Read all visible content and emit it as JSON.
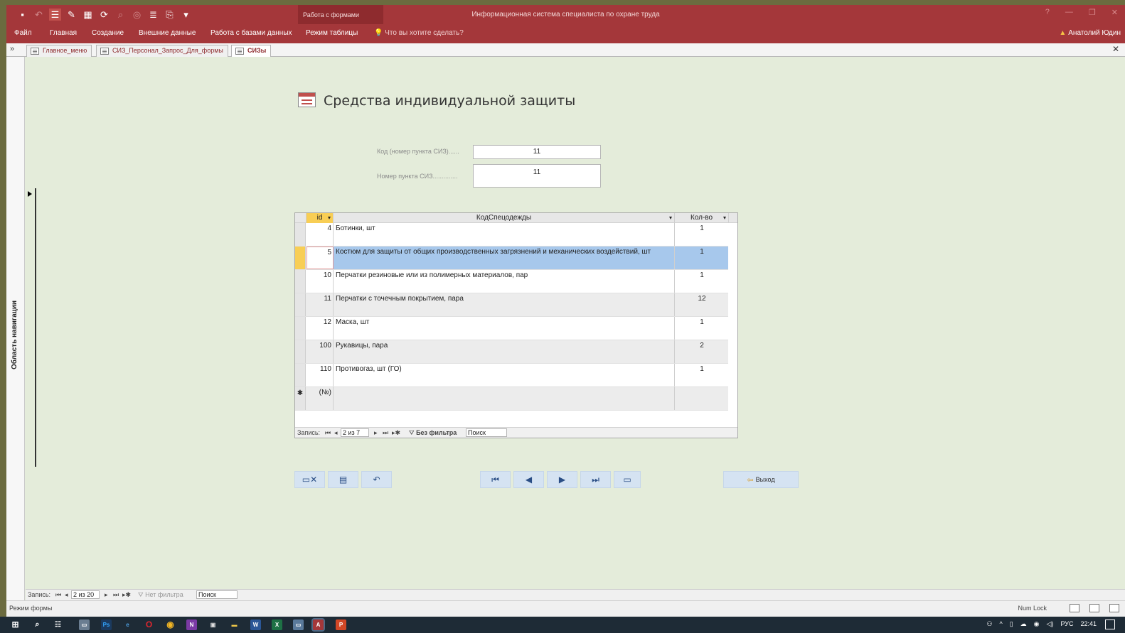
{
  "titlebar": {
    "context_group": "Работа с формами",
    "app_title": "Информационная система специалиста по охране труда",
    "controls": [
      "?",
      "—",
      "❐",
      "✕"
    ]
  },
  "ribbon": {
    "tabs": [
      "Файл",
      "Главная",
      "Создание",
      "Внешние данные",
      "Работа с базами данных",
      "Режим таблицы"
    ],
    "tell_me": "Что вы хотите сделать?",
    "user": "Анатолий Юдин"
  },
  "doc_tabs": [
    "Главное_меню",
    "СИЗ_Персонал_Запрос_Для_формы",
    "СИЗы"
  ],
  "nav_pane": {
    "label": "Область навигации"
  },
  "form": {
    "title": "Средства индивидуальной защиты",
    "fields": [
      {
        "label": "Код (номер пункта СИЗ)......",
        "value": "11"
      },
      {
        "label": "Номер пункта СИЗ..............",
        "value": "11"
      }
    ]
  },
  "datasheet": {
    "columns": [
      "id",
      "КодСпецодежды",
      "Кол-во"
    ],
    "rows": [
      {
        "id": "4",
        "name": "Ботинки, шт",
        "qty": "1"
      },
      {
        "id": "5",
        "name": "Костюм для защиты от общих производственных загрязнений и механических воздействий, шт",
        "qty": "1"
      },
      {
        "id": "10",
        "name": "Перчатки резиновые или из полимерных материалов, пар",
        "qty": "1"
      },
      {
        "id": "11",
        "name": "Перчатки с точечным покрытием, пара",
        "qty": "12"
      },
      {
        "id": "12",
        "name": "Маска, шт",
        "qty": "1"
      },
      {
        "id": "100",
        "name": "Рукавицы, пара",
        "qty": "2"
      },
      {
        "id": "110",
        "name": "Противогаз, шт (ГО)",
        "qty": "1"
      }
    ],
    "new_row_marker": "✱",
    "new_row_id": "(№)",
    "nav": {
      "label": "Запись:",
      "position": "2 из 7",
      "filter": "Без фильтра",
      "search": "Поиск"
    }
  },
  "buttons": {
    "exit": "Выход"
  },
  "form_nav": {
    "label": "Запись:",
    "position": "2 из 20",
    "filter": "Нет фильтра",
    "search": "Поиск"
  },
  "status": {
    "mode": "Режим формы",
    "numlock": "Num Lock"
  },
  "taskbar": {
    "lang": "РУС",
    "time": "22:41"
  }
}
